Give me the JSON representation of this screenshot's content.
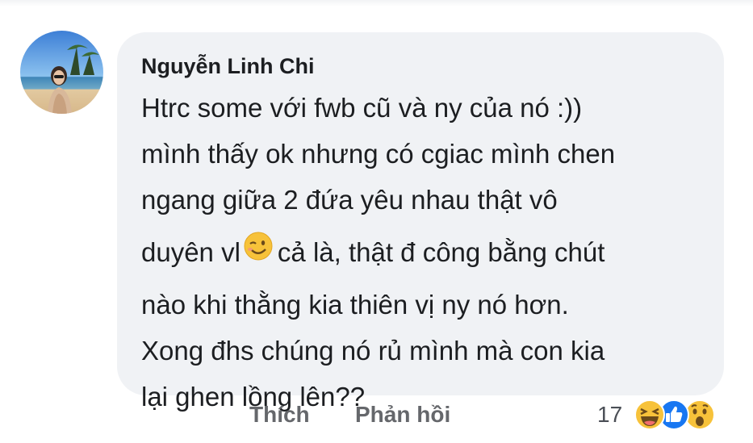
{
  "comment": {
    "author": "Nguyễn Linh Chi",
    "lines": [
      "Htrc some với fwb cũ và ny của nó :))",
      "mình thấy ok nhưng có cgiac mình chen",
      "ngang giữa 2 đứa yêu nhau thật vô",
      "duyên vl",
      "cả là, thật đ công bằng chút",
      "nào khi thằng kia thiên vị ny nó hơn.",
      "Xong đhs chúng nó rủ mình mà con kia",
      "lại ghen lồng lên??"
    ]
  },
  "actions": {
    "like_label": "Thích",
    "reply_label": "Phản hồi"
  },
  "reactions": {
    "count": "17",
    "icons": [
      "haha-icon",
      "like-icon",
      "wow-icon"
    ]
  },
  "colors": {
    "bubble": "#f0f2f5",
    "text": "#1c1e21",
    "muted": "#65676b",
    "like_blue": "#1877f2",
    "emoji_yellow": "#f7c23a"
  }
}
